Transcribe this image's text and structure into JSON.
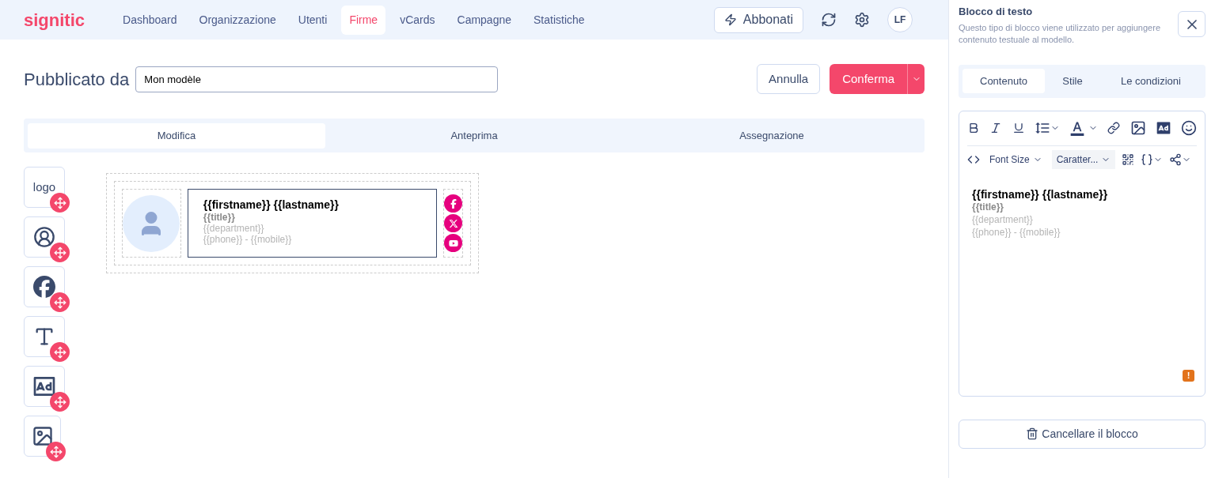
{
  "brand": {
    "name": "signitic"
  },
  "nav": [
    {
      "label": "Dashboard",
      "selected": false
    },
    {
      "label": "Organizzazione",
      "selected": false
    },
    {
      "label": "Utenti",
      "selected": false
    },
    {
      "label": "Firme",
      "selected": true
    },
    {
      "label": "vCards",
      "selected": false
    },
    {
      "label": "Campagne",
      "selected": false
    },
    {
      "label": "Statistiche",
      "selected": false
    }
  ],
  "header": {
    "subscribe_button": "Abbonati",
    "user_initials": "LF"
  },
  "editor": {
    "title_label": "Pubblicato da",
    "name_value": "Mon modèle",
    "cancel_button": "Annulla",
    "confirm_button": "Conferma"
  },
  "tabs": [
    {
      "label": "Modifica",
      "selected": true
    },
    {
      "label": "Anteprima",
      "selected": false
    },
    {
      "label": "Assegnazione",
      "selected": false
    }
  ],
  "palette": [
    {
      "kind": "logo",
      "label": "logo"
    },
    {
      "kind": "avatar"
    },
    {
      "kind": "social"
    },
    {
      "kind": "text"
    },
    {
      "kind": "banner"
    },
    {
      "kind": "image"
    }
  ],
  "signature": {
    "lines": [
      {
        "text": "{{firstname}} {{lastname}}",
        "kind": "name"
      },
      {
        "text": "{{title}}",
        "kind": "title"
      },
      {
        "text": "{{department}}",
        "kind": "detail"
      },
      {
        "text": "{{phone}} - {{mobile}}",
        "kind": "detail"
      }
    ],
    "socials": [
      {
        "kind": "facebook"
      },
      {
        "kind": "x"
      },
      {
        "kind": "youtube"
      }
    ]
  },
  "panel": {
    "title": "Blocco di testo",
    "description": "Questo tipo di blocco viene utilizzato per aggiungere contenuto testuale al modello.",
    "tabs": [
      {
        "label": "Contenuto",
        "selected": true
      },
      {
        "label": "Stile",
        "selected": false
      },
      {
        "label": "Le condizioni",
        "selected": false
      }
    ],
    "toolbar": {
      "font_size": "Font Size",
      "font_family": "Caratter..."
    },
    "content": [
      {
        "text": "{{firstname}} {{lastname}}",
        "kind": "name"
      },
      {
        "text": "{{title}}",
        "kind": "title"
      },
      {
        "text": "{{department}}",
        "kind": "detail"
      },
      {
        "text": "{{phone}} - {{mobile}}",
        "kind": "detail"
      }
    ],
    "warning_badge": "!",
    "delete_button": "Cancellare il blocco"
  }
}
